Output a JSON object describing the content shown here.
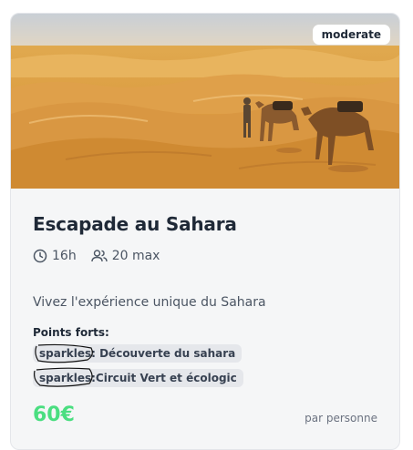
{
  "card": {
    "difficulty_badge": "moderate",
    "title": "Escapade au Sahara",
    "duration": "16h",
    "capacity": "20 max",
    "description": "Vivez l'expérience unique du Sahara",
    "highlights_label": "Points forts:",
    "highlights": [
      "sparkles: Découverte du sahara",
      "sparkles:Circuit Vert et écologic"
    ],
    "price": "60€",
    "price_unit": "par personne"
  },
  "icons": {
    "duration": "clock-icon",
    "capacity": "users-icon"
  },
  "colors": {
    "price": "#4ade80",
    "card_bg": "#f5f6f7",
    "chip_bg": "#e5e7eb",
    "text_dark": "#1f2937",
    "text_muted": "#4b5563"
  }
}
